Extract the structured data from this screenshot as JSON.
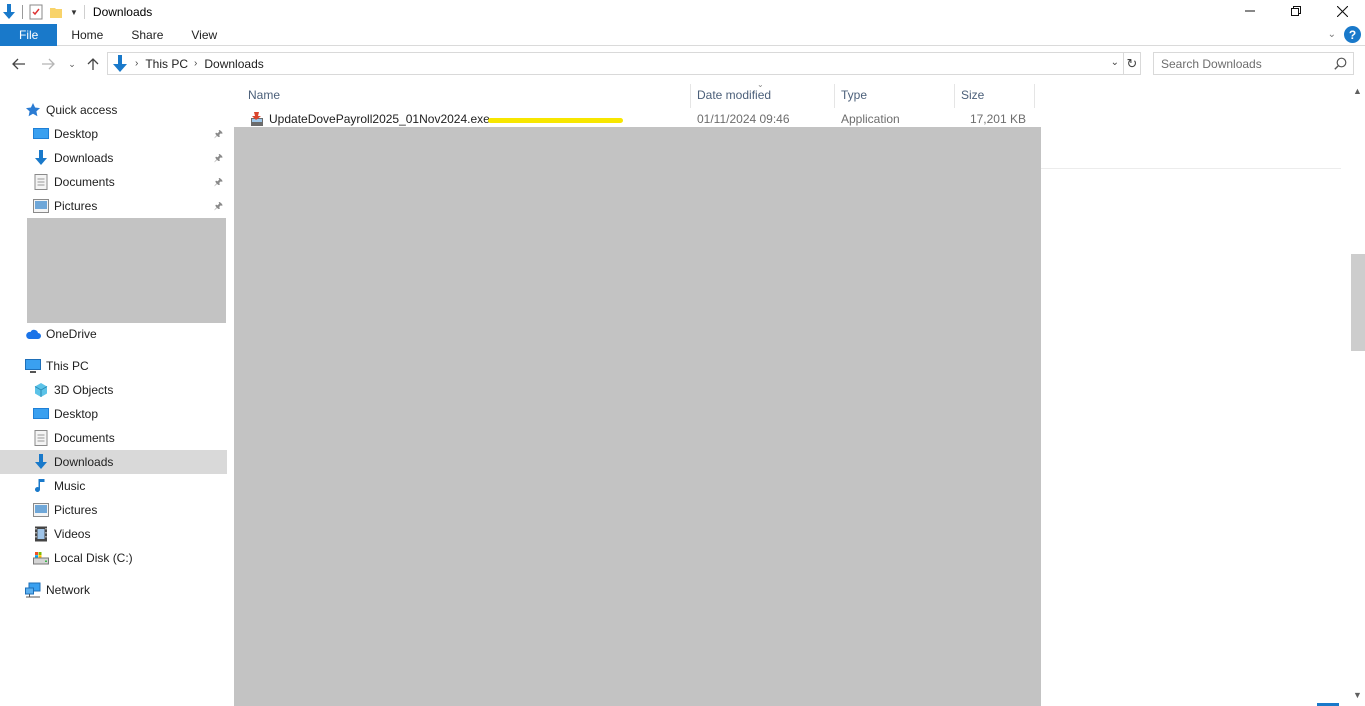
{
  "window": {
    "title": "Downloads",
    "controls": [
      "minimize",
      "restore",
      "close"
    ]
  },
  "ribbon": {
    "tabs": [
      {
        "label": "File"
      },
      {
        "label": "Home"
      },
      {
        "label": "Share"
      },
      {
        "label": "View"
      }
    ]
  },
  "address": {
    "breadcrumb": [
      "This PC",
      "Downloads"
    ]
  },
  "search": {
    "placeholder": "Search Downloads"
  },
  "navigation": {
    "quick_access": "Quick access",
    "quick_items": [
      "Desktop",
      "Downloads",
      "Documents",
      "Pictures"
    ],
    "onedrive": "OneDrive",
    "this_pc": "This PC",
    "pc_items": [
      "3D Objects",
      "Desktop",
      "Documents",
      "Downloads",
      "Music",
      "Pictures",
      "Videos",
      "Local Disk (C:)"
    ],
    "network": "Network",
    "selected": "Downloads"
  },
  "columns": {
    "name": "Name",
    "date": "Date modified",
    "type": "Type",
    "size": "Size"
  },
  "files": [
    {
      "name": "UpdateDovePayroll2025_01Nov2024.exe",
      "date": "01/11/2024 09:46",
      "type": "Application",
      "size": "17,201 KB"
    }
  ],
  "colors": {
    "accent": "#1979ca",
    "highlight": "#f7e600",
    "redaction": "#c3c3c3",
    "selected_nav": "#d9d9d9"
  }
}
